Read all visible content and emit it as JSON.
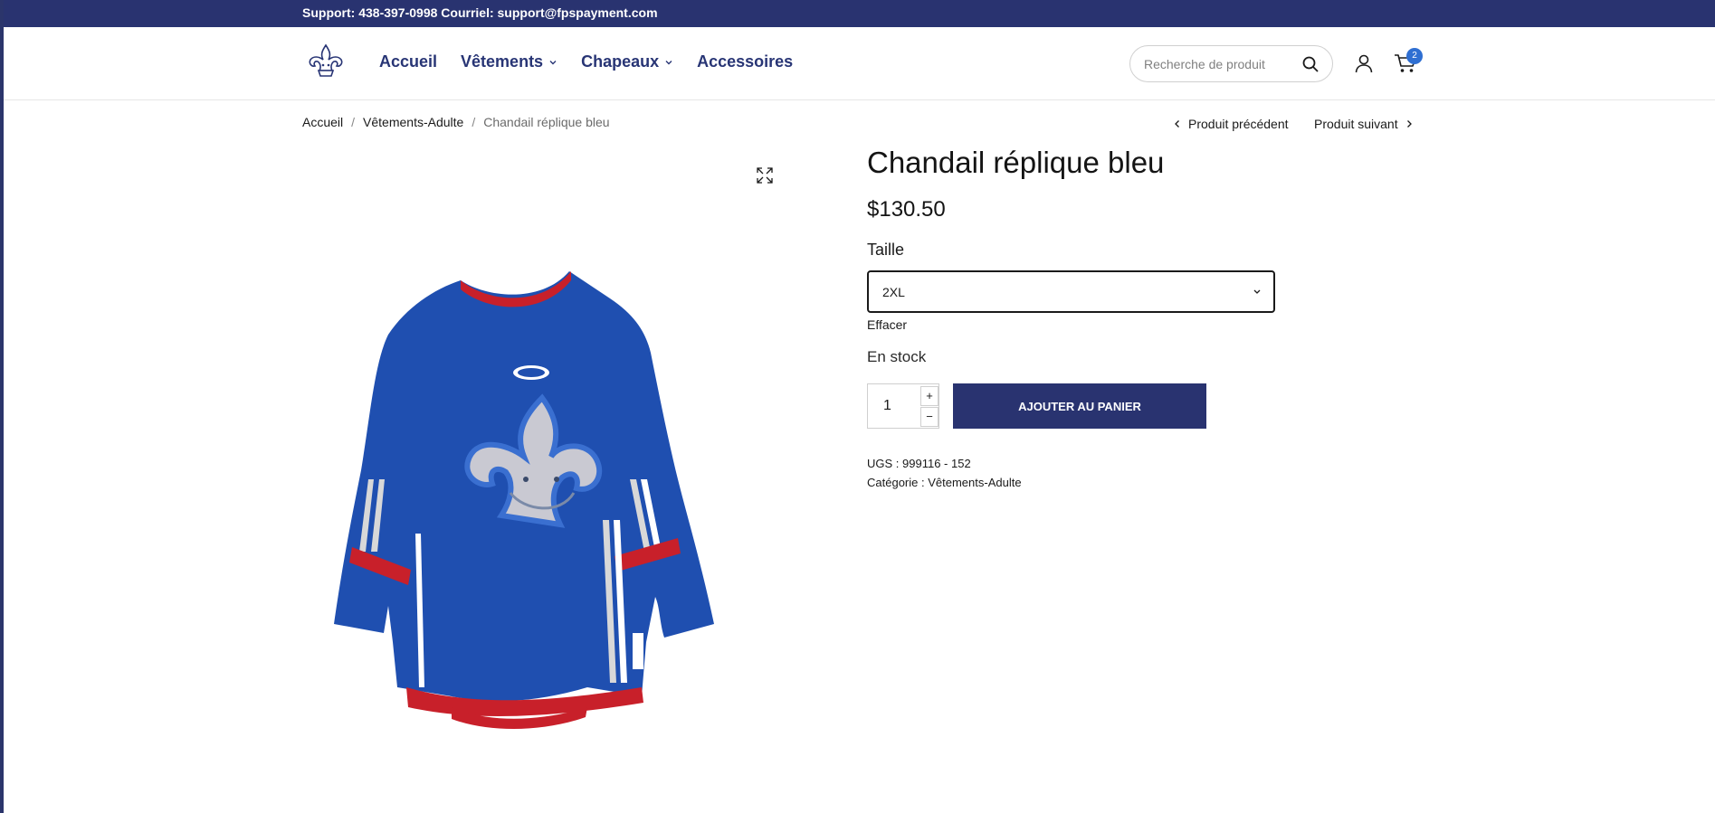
{
  "topbar": {
    "text": "Support: 438-397-0998 Courriel: support@fpspayment.com"
  },
  "nav": {
    "items": [
      {
        "label": "Accueil",
        "has_dropdown": false
      },
      {
        "label": "Vêtements",
        "has_dropdown": true
      },
      {
        "label": "Chapeaux",
        "has_dropdown": true
      },
      {
        "label": "Accessoires",
        "has_dropdown": false
      }
    ]
  },
  "search": {
    "placeholder": "Recherche de produit",
    "icon": "search-icon"
  },
  "cart": {
    "count": "2"
  },
  "breadcrumb": {
    "items": [
      "Accueil",
      "Vêtements-Adulte",
      "Chandail réplique bleu"
    ],
    "separator": "/"
  },
  "product_nav": {
    "prev": "Produit précédent",
    "next": "Produit suivant"
  },
  "product": {
    "title": "Chandail réplique bleu",
    "price": "$130.50",
    "size_label": "Taille",
    "size_selected": "2XL",
    "clear": "Effacer",
    "stock": "En stock",
    "quantity": "1",
    "add_to_cart": "AJOUTER AU PANIER",
    "sku_label": "UGS :",
    "sku": "999116 - 152",
    "category_label": "Catégorie :",
    "category": "Vêtements-Adulte"
  },
  "colors": {
    "brand": "#293370",
    "badge": "#2f6fd2",
    "jersey_blue": "#1f4fb0",
    "jersey_red": "#c8202a"
  }
}
